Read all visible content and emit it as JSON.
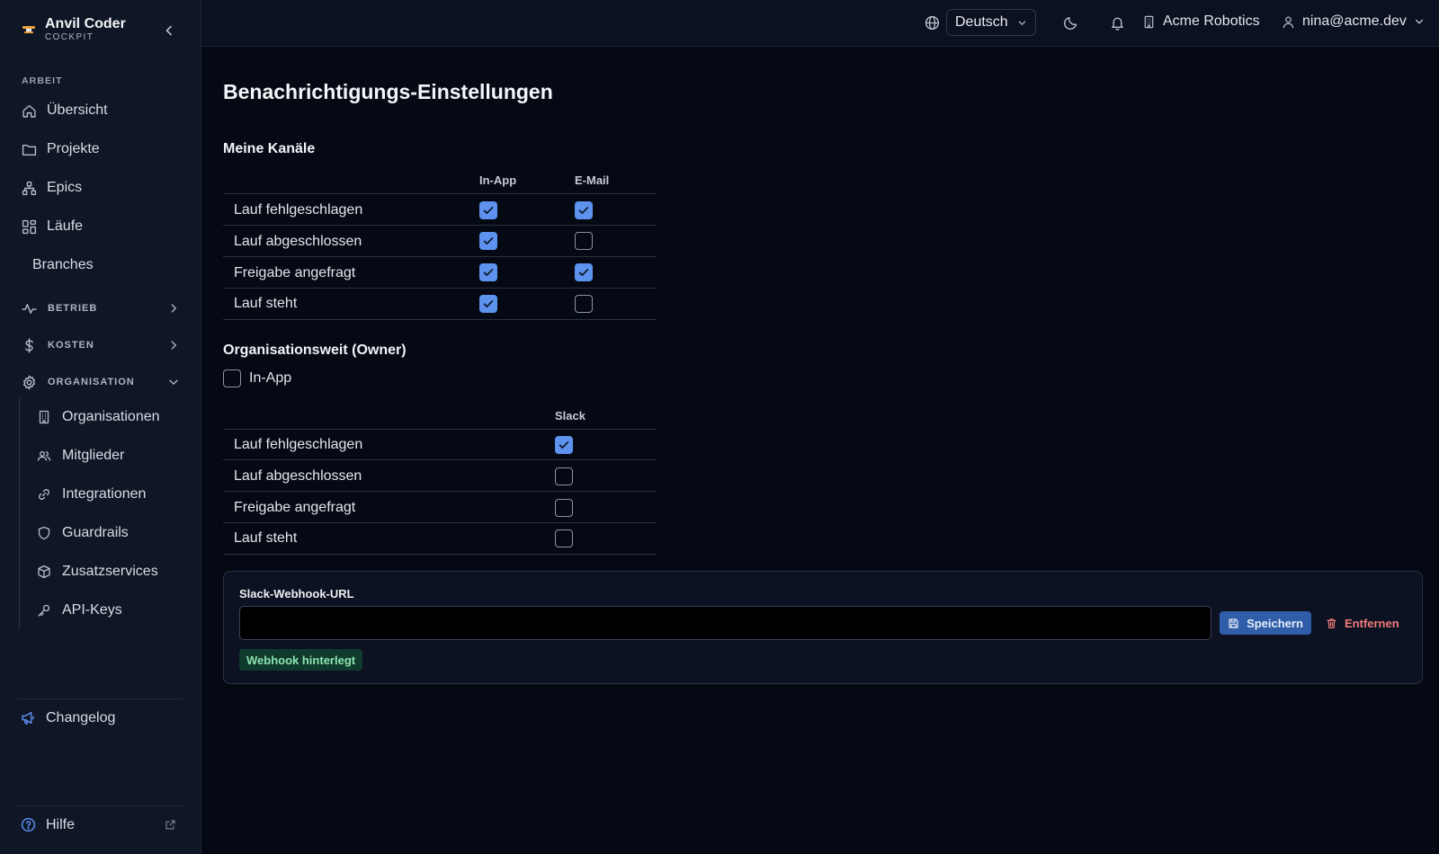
{
  "brand": {
    "name": "Anvil Coder",
    "sub": "COCKPIT"
  },
  "sidebar": {
    "section_work": "ARBEIT",
    "items": [
      "Übersicht",
      "Projekte",
      "Epics",
      "Läufe",
      "Branches"
    ],
    "groups": {
      "betrieb": "BETRIEB",
      "kosten": "KOSTEN",
      "organisation": "ORGANISATION"
    },
    "org_items": [
      "Organisationen",
      "Mitglieder",
      "Integrationen",
      "Guardrails",
      "Zusatzservices",
      "API-Keys"
    ],
    "changelog": "Changelog",
    "help": "Hilfe"
  },
  "topbar": {
    "language": "Deutsch",
    "org": "Acme Robotics",
    "user": "nina@acme.dev"
  },
  "main": {
    "title": "Benachrichtigungs-Einstellungen",
    "my_channels": {
      "heading": "Meine Kanäle",
      "col_inapp": "In-App",
      "col_email": "E-Mail",
      "rows": [
        {
          "label": "Lauf fehlgeschlagen",
          "inapp": true,
          "email": true
        },
        {
          "label": "Lauf abgeschlossen",
          "inapp": true,
          "email": false
        },
        {
          "label": "Freigabe angefragt",
          "inapp": true,
          "email": true
        },
        {
          "label": "Lauf steht",
          "inapp": true,
          "email": false
        }
      ]
    },
    "org_wide": {
      "heading": "Organisationsweit (Owner)",
      "inapp_label": "In-App",
      "inapp_checked": false,
      "col_slack": "Slack",
      "rows": [
        {
          "label": "Lauf fehlgeschlagen",
          "slack": true
        },
        {
          "label": "Lauf abgeschlossen",
          "slack": false
        },
        {
          "label": "Freigabe angefragt",
          "slack": false
        },
        {
          "label": "Lauf steht",
          "slack": false
        }
      ]
    },
    "webhook": {
      "label": "Slack-Webhook-URL",
      "value": "",
      "placeholder": "",
      "save": "Speichern",
      "remove": "Entfernen",
      "status": "Webhook hinterlegt"
    }
  },
  "colors": {
    "accent": "#5d93ee",
    "danger": "#f07c7c",
    "success": "#8ee3b0",
    "background": "#050914",
    "sidebar": "#0f1626"
  }
}
